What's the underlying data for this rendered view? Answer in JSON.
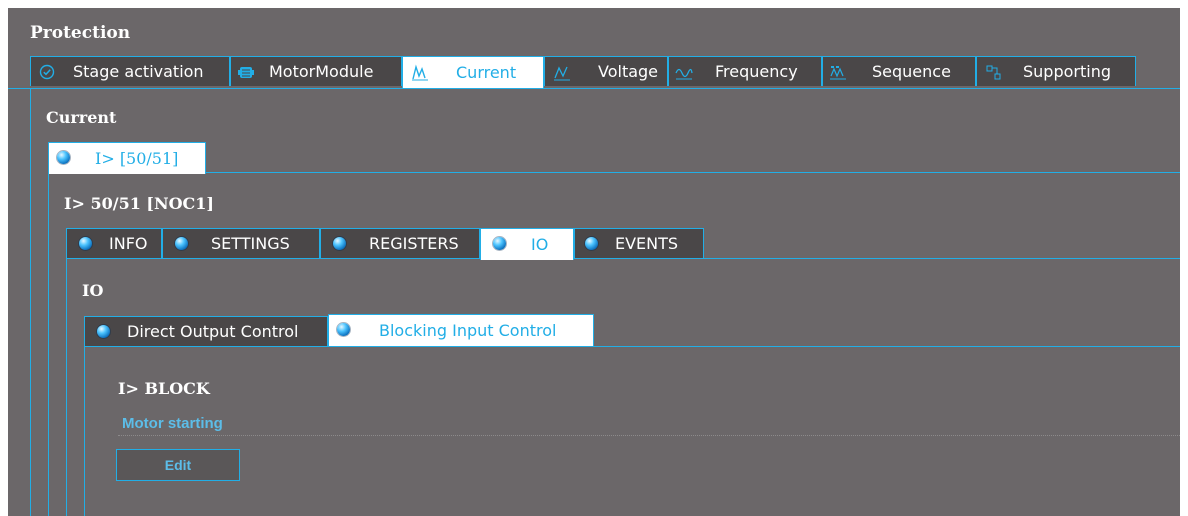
{
  "protection": {
    "title": "Protection",
    "tabs": [
      {
        "label": "Stage activation",
        "icon": "check-circle-icon"
      },
      {
        "label": "MotorModule",
        "icon": "motor-icon"
      },
      {
        "label": "Current",
        "icon": "current-wave-icon",
        "active": true
      },
      {
        "label": "Voltage",
        "icon": "voltage-icon"
      },
      {
        "label": "Frequency",
        "icon": "frequency-icon"
      },
      {
        "label": "Sequence",
        "icon": "sequence-icon"
      },
      {
        "label": "Supporting",
        "icon": "supporting-icon"
      }
    ]
  },
  "current": {
    "title": "Current",
    "tabs": [
      {
        "label": "I> [50/51]",
        "active": true
      }
    ]
  },
  "stage": {
    "title": "I> 50/51 [NOC1]",
    "tabs": [
      {
        "label": "INFO"
      },
      {
        "label": "SETTINGS"
      },
      {
        "label": "REGISTERS"
      },
      {
        "label": "IO",
        "active": true
      },
      {
        "label": "EVENTS"
      }
    ]
  },
  "io": {
    "title": "IO",
    "tabs": [
      {
        "label": "Direct Output Control"
      },
      {
        "label": "Blocking Input Control",
        "active": true
      }
    ]
  },
  "block": {
    "title": "I> BLOCK",
    "item_label": "Motor starting",
    "edit_label": "Edit"
  },
  "colors": {
    "accent": "#22aee6",
    "background": "#6b6769",
    "tab_inactive": "#4a4748",
    "link": "#5cbde8"
  }
}
